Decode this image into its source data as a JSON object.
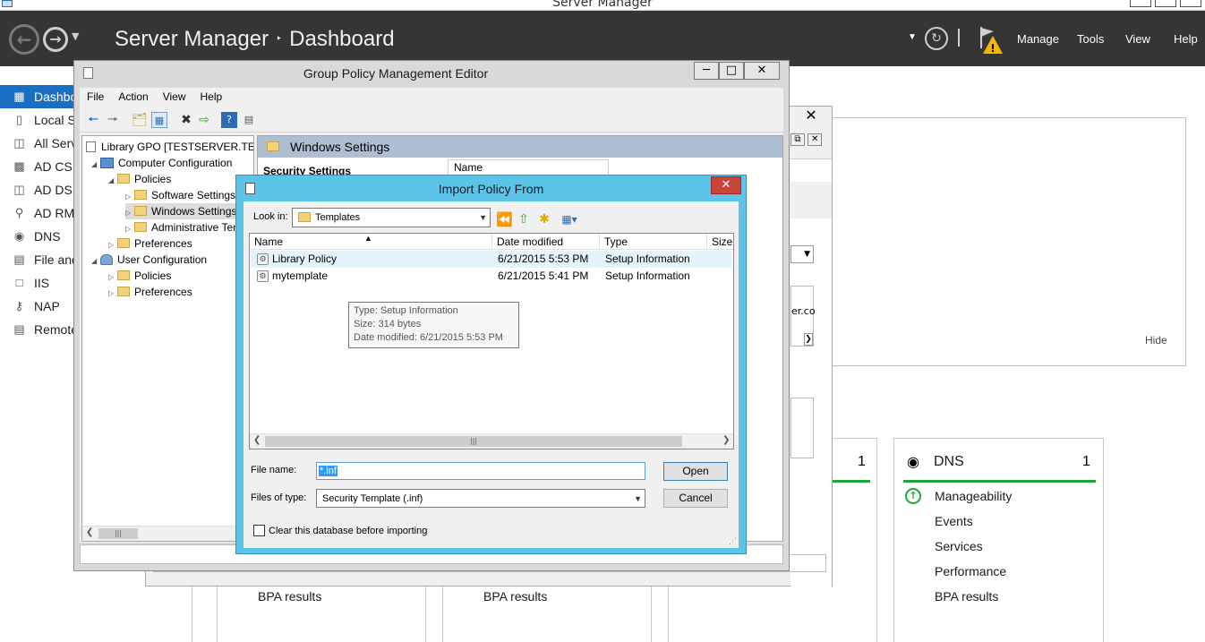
{
  "server_manager": {
    "window_title": "Server Manager",
    "breadcrumb": {
      "root": "Server Manager",
      "separator": "‣",
      "page": "Dashboard"
    },
    "header_menu": [
      "Manage",
      "Tools",
      "View",
      "Help"
    ],
    "sidebar": [
      {
        "label": "Dashboard",
        "icon": "dashboard-icon",
        "active": true
      },
      {
        "label": "Local Server",
        "icon": "server-icon"
      },
      {
        "label": "All Servers",
        "icon": "servers-icon"
      },
      {
        "label": "AD CS",
        "icon": "ad-cs-icon"
      },
      {
        "label": "AD DS",
        "icon": "ad-ds-icon"
      },
      {
        "label": "AD RMS",
        "icon": "ad-rms-icon"
      },
      {
        "label": "DNS",
        "icon": "dns-icon"
      },
      {
        "label": "File and Storage Services",
        "icon": "file-storage-icon"
      },
      {
        "label": "IIS",
        "icon": "iis-icon"
      },
      {
        "label": "NAP",
        "icon": "nap-icon"
      },
      {
        "label": "Remote Access",
        "icon": "remote-access-icon"
      }
    ],
    "welcome_hide": "Hide",
    "dns_tile": {
      "title": "DNS",
      "count": "1",
      "items": [
        "Manageability",
        "Events",
        "Services",
        "Performance",
        "BPA results"
      ]
    },
    "left_tile_count": "1",
    "bpa_labels": [
      "BPA results",
      "BPA results"
    ],
    "partial_text": "er.co",
    "status_color": "#1fa83a",
    "accent_color": "#1a6fc4"
  },
  "gpme": {
    "title": "Group Policy Management Editor",
    "menu": [
      "File",
      "Action",
      "View",
      "Help"
    ],
    "tree": [
      {
        "label": "Library GPO [TESTSERVER.TESTSERVER.CO",
        "level": 0,
        "expander": ""
      },
      {
        "label": "Computer Configuration",
        "level": 1,
        "expander": "◢"
      },
      {
        "label": "Policies",
        "level": 2,
        "expander": "◢"
      },
      {
        "label": "Software Settings",
        "level": 3,
        "expander": "▷"
      },
      {
        "label": "Windows Settings",
        "level": 3,
        "expander": "▷"
      },
      {
        "label": "Administrative Templates",
        "level": 3,
        "expander": "▷"
      },
      {
        "label": "Preferences",
        "level": 2,
        "expander": "▷"
      },
      {
        "label": "User Configuration",
        "level": 1,
        "expander": "◢"
      },
      {
        "label": "Policies",
        "level": 2,
        "expander": "▷"
      },
      {
        "label": "Preferences",
        "level": 2,
        "expander": "▷"
      }
    ],
    "right_header": "Windows Settings",
    "section_title": "Security Settings",
    "name_column": "Name"
  },
  "dialog": {
    "title": "Import Policy From",
    "look_in_label": "Look in:",
    "look_in_value": "Templates",
    "columns": [
      "Name",
      "Date modified",
      "Type",
      "Size"
    ],
    "files": [
      {
        "name": "Library Policy",
        "date": "6/21/2015 5:53 PM",
        "type": "Setup Information"
      },
      {
        "name": "mytemplate",
        "date": "6/21/2015 5:41 PM",
        "type": "Setup Information"
      }
    ],
    "tooltip": {
      "type": "Type: Setup Information",
      "size": "Size: 314 bytes",
      "date": "Date modified: 6/21/2015 5:53 PM"
    },
    "file_name_label": "File name:",
    "file_name_value": "*.inf",
    "files_of_type_label": "Files of type:",
    "files_of_type_value": "Security Template (.inf)",
    "open_button": "Open",
    "cancel_button": "Cancel",
    "clear_db_label": "Clear this database before importing",
    "close_color": "#c9453a",
    "frame_color": "#5bc4e8"
  }
}
